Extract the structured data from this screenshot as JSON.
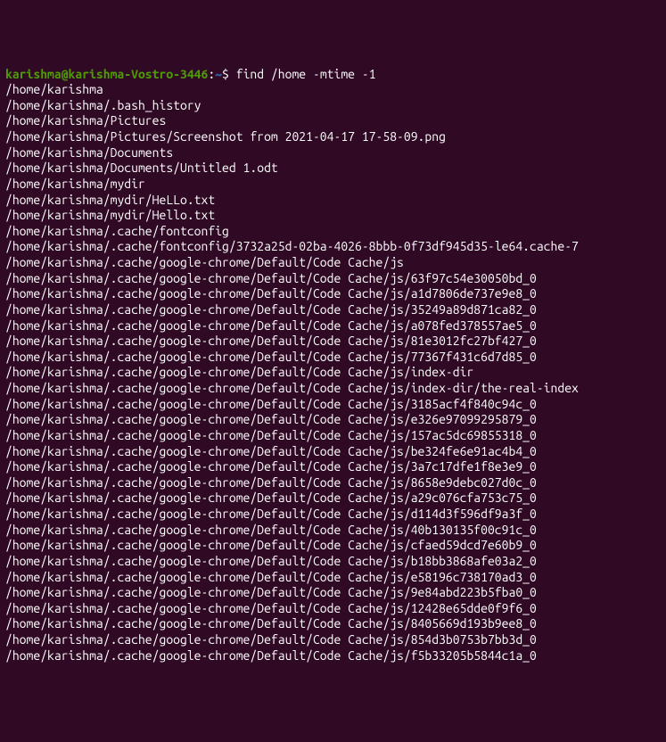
{
  "prompt": {
    "user_host": "karishma@karishma-Vostro-3446",
    "colon": ":",
    "path": "~",
    "dollar": "$ ",
    "command": "find /home -mtime -1"
  },
  "output": [
    "/home/karishma",
    "/home/karishma/.bash_history",
    "/home/karishma/Pictures",
    "/home/karishma/Pictures/Screenshot from 2021-04-17 17-58-09.png",
    "/home/karishma/Documents",
    "/home/karishma/Documents/Untitled 1.odt",
    "/home/karishma/mydir",
    "/home/karishma/mydir/HeLLo.txt",
    "/home/karishma/mydir/Hello.txt",
    "/home/karishma/.cache/fontconfig",
    "/home/karishma/.cache/fontconfig/3732a25d-02ba-4026-8bbb-0f73df945d35-le64.cache-7",
    "/home/karishma/.cache/google-chrome/Default/Code Cache/js",
    "/home/karishma/.cache/google-chrome/Default/Code Cache/js/63f97c54e30050bd_0",
    "/home/karishma/.cache/google-chrome/Default/Code Cache/js/a1d7806de737e9e8_0",
    "/home/karishma/.cache/google-chrome/Default/Code Cache/js/35249a89d871ca82_0",
    "/home/karishma/.cache/google-chrome/Default/Code Cache/js/a078fed378557ae5_0",
    "/home/karishma/.cache/google-chrome/Default/Code Cache/js/81e3012fc27bf427_0",
    "/home/karishma/.cache/google-chrome/Default/Code Cache/js/77367f431c6d7d85_0",
    "/home/karishma/.cache/google-chrome/Default/Code Cache/js/index-dir",
    "/home/karishma/.cache/google-chrome/Default/Code Cache/js/index-dir/the-real-index",
    "/home/karishma/.cache/google-chrome/Default/Code Cache/js/3185acf4f840c94c_0",
    "/home/karishma/.cache/google-chrome/Default/Code Cache/js/e326e97099295879_0",
    "/home/karishma/.cache/google-chrome/Default/Code Cache/js/157ac5dc69855318_0",
    "/home/karishma/.cache/google-chrome/Default/Code Cache/js/be324fe6e91ac4b4_0",
    "/home/karishma/.cache/google-chrome/Default/Code Cache/js/3a7c17dfe1f8e3e9_0",
    "/home/karishma/.cache/google-chrome/Default/Code Cache/js/8658e9debc027d0c_0",
    "/home/karishma/.cache/google-chrome/Default/Code Cache/js/a29c076cfa753c75_0",
    "/home/karishma/.cache/google-chrome/Default/Code Cache/js/d114d3f596df9a3f_0",
    "/home/karishma/.cache/google-chrome/Default/Code Cache/js/40b130135f00c91c_0",
    "/home/karishma/.cache/google-chrome/Default/Code Cache/js/cfaed59dcd7e60b9_0",
    "/home/karishma/.cache/google-chrome/Default/Code Cache/js/b18bb3868afe03a2_0",
    "/home/karishma/.cache/google-chrome/Default/Code Cache/js/e58196c738170ad3_0",
    "/home/karishma/.cache/google-chrome/Default/Code Cache/js/9e84abd223b5fba0_0",
    "/home/karishma/.cache/google-chrome/Default/Code Cache/js/12428e65dde0f9f6_0",
    "/home/karishma/.cache/google-chrome/Default/Code Cache/js/8405669d193b9ee8_0",
    "/home/karishma/.cache/google-chrome/Default/Code Cache/js/854d3b0753b7bb3d_0",
    "/home/karishma/.cache/google-chrome/Default/Code Cache/js/f5b33205b5844c1a_0"
  ]
}
